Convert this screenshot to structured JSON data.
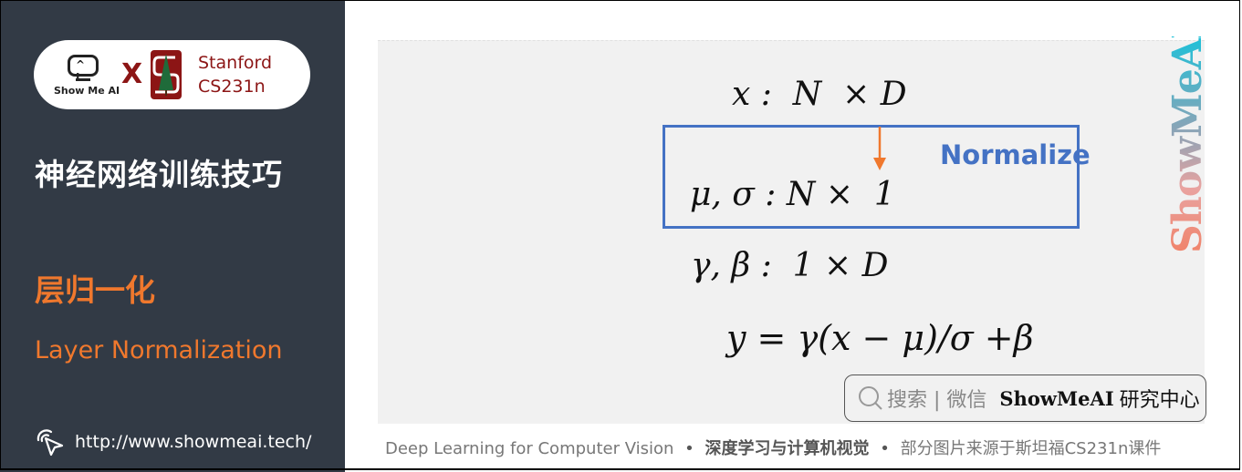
{
  "sidebar": {
    "logo": {
      "showmeai_label": "Show Me AI",
      "showmeai_eyes": "^ I",
      "cross": "X",
      "stanford_line1": "Stanford",
      "stanford_line2": "CS231n"
    },
    "course_title": "神经网络训练技巧",
    "section_title_cn": "层归一化",
    "section_title_en": "Layer Normalization",
    "url": "http://www.showmeai.tech/",
    "icons": {
      "url": "pointer-click-icon"
    }
  },
  "slide": {
    "equations": {
      "x_shape": "x :  N  × D",
      "mu_sigma_shape": "μ, σ : N ×  1",
      "gamma_beta_shape": "γ, β :  1 × D",
      "output_formula": "y = γ(x − μ)/σ +β"
    },
    "normalize_label": "Normalize",
    "watermark": "ShowMeAI",
    "colors": {
      "box": "#4472c4",
      "arrow": "#f0782d",
      "accent": "#f0782d"
    }
  },
  "search_badge": {
    "hint": "搜索 | 微信",
    "brand": "ShowMeAI",
    "brand_cn": "研究中心"
  },
  "footer": {
    "course_en": "Deep Learning for Computer Vision",
    "sep": "•",
    "course_cn": "深度学习与计算机视觉",
    "credit": "部分图片来源于斯坦福CS231n课件"
  }
}
